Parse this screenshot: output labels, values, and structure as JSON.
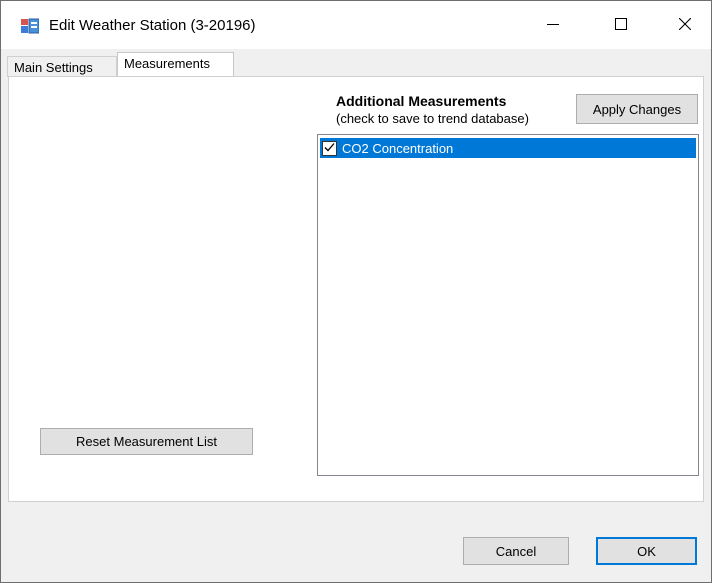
{
  "window": {
    "title": "Edit Weather Station (3-20196)",
    "app_icon": "app-window-icon",
    "controls": {
      "minimize_icon": "minimize-icon",
      "maximize_icon": "maximize-icon",
      "close_icon": "close-icon"
    }
  },
  "tabs": [
    {
      "label": "Main Settings",
      "selected": false
    },
    {
      "label": "Measurements",
      "selected": true
    }
  ],
  "measurements": {
    "heading": "Additional Measurements",
    "subheading": "(check to save to trend database)",
    "apply_label": "Apply Changes",
    "items": [
      {
        "label": "CO2 Concentration",
        "checked": true,
        "selected": true
      }
    ],
    "reset_label": "Reset Measurement List"
  },
  "footer": {
    "cancel_label": "Cancel",
    "ok_label": "OK"
  },
  "colors": {
    "selection": "#0078d7",
    "window_bg": "#f0f0f0",
    "button_bg": "#e1e1e1"
  }
}
